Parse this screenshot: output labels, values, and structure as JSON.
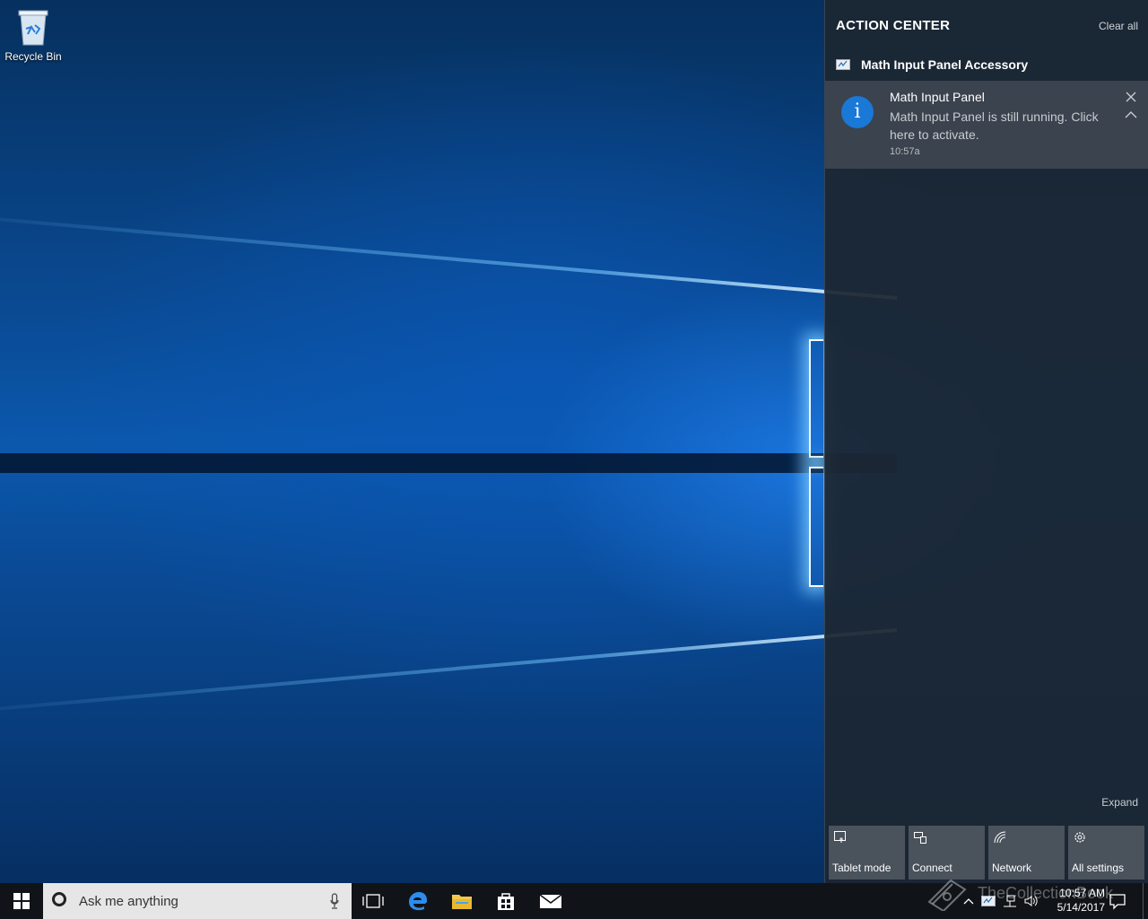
{
  "desktop": {
    "icons": [
      {
        "label": "Recycle Bin",
        "icon": "recycle-bin-icon"
      }
    ]
  },
  "action_center": {
    "title": "ACTION CENTER",
    "clear_all_label": "Clear all",
    "app_group": {
      "icon": "math-input-panel-icon",
      "name": "Math Input Panel Accessory"
    },
    "notification": {
      "icon": "info-icon",
      "icon_glyph": "i",
      "icon_color": "#1a78d6",
      "title": "Math Input Panel",
      "body": "Math Input Panel is still running. Click here to activate.",
      "time": "10:57a"
    },
    "expand_label": "Expand",
    "quick_actions": [
      {
        "label": "Tablet mode",
        "icon": "tablet-mode-icon"
      },
      {
        "label": "Connect",
        "icon": "connect-icon"
      },
      {
        "label": "Network",
        "icon": "network-icon"
      },
      {
        "label": "All settings",
        "icon": "gear-icon"
      }
    ]
  },
  "taskbar": {
    "search_placeholder": "Ask me anything",
    "pinned_apps": [
      "task-view-icon",
      "edge-icon",
      "file-explorer-icon",
      "store-icon",
      "mail-icon"
    ],
    "clock": {
      "time": "10:57 AM",
      "date": "5/14/2017"
    }
  },
  "watermark": {
    "text": "TheCollectionBook"
  },
  "colors": {
    "accent": "#1a78d6",
    "taskbar": "#101418",
    "action_center_bg": "#1c2632"
  }
}
